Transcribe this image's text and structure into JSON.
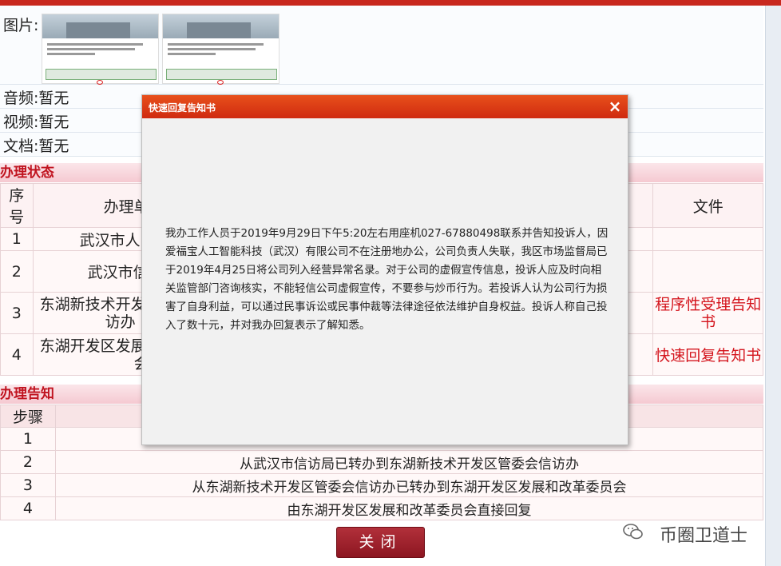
{
  "attachments": {
    "images_label": "图片:",
    "audio_label": "音频:暂无",
    "video_label": "视频:暂无",
    "doc_label": "文档:暂无"
  },
  "status_section": {
    "title": "办理状态",
    "headers": [
      "序号",
      "办理单",
      "文件"
    ],
    "rows": [
      {
        "no": "1",
        "unit": "武汉市人",
        "file": ""
      },
      {
        "no": "2",
        "unit": "武汉市信",
        "file": ""
      },
      {
        "no": "3",
        "unit": "东湖新技术开发",
        "unit2": "访办",
        "file": "程序性受理告知书"
      },
      {
        "no": "4",
        "unit": "东湖开发区发展",
        "unit2": "会",
        "file": "快速回复告知书"
      }
    ]
  },
  "notice_section": {
    "title": "办理告知",
    "header": "步骤",
    "rows": [
      {
        "no": "1",
        "text": ""
      },
      {
        "no": "2",
        "text": "从武汉市信访局已转办到东湖新技术开发区管委会信访办"
      },
      {
        "no": "3",
        "text": "从东湖新技术开发区管委会信访办已转办到东湖开发区发展和改革委员会"
      },
      {
        "no": "4",
        "text": "由东湖开发区发展和改革委员会直接回复"
      }
    ]
  },
  "modal": {
    "title": "快速回复告知书",
    "close": "×",
    "body": "我办工作人员于2019年9月29日下午5:20左右用座机027-67880498联系并告知投诉人，因爱福宝人工智能科技（武汉）有限公司不在注册地办公，公司负责人失联，我区市场监督局已于2019年4月25日将公司列入经营异常名录。对于公司的虚假宣传信息，投诉人应及时向相关监管部门咨询核实，不能轻信公司虚假宣传，不要参与炒币行为。若投诉人认为公司行为损害了自身利益，可以通过民事诉讼或民事仲裁等法律途径依法维护自身权益。投诉人称自己投入了数十元，并对我办回复表示了解知悉。"
  },
  "footer": {
    "close_button": "关闭",
    "watermark": "币圈卫道士"
  },
  "colors": {
    "accent_red": "#c8281e",
    "link_red": "#d4141c"
  }
}
